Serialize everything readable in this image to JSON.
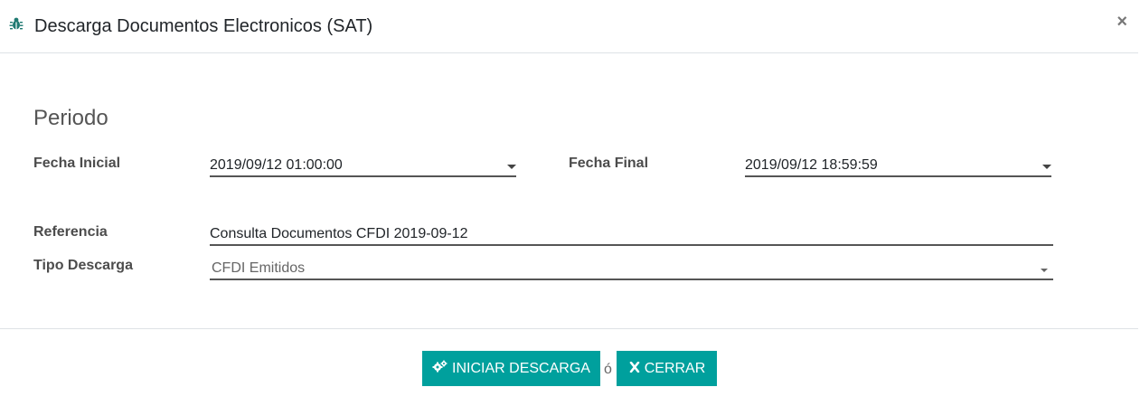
{
  "dialog": {
    "title": "Descarga Documentos Electronicos (SAT)",
    "close_symbol": "×",
    "icons": {
      "title": "bug-icon",
      "close": "close-icon"
    }
  },
  "form": {
    "section_title": "Periodo",
    "fecha_inicial": {
      "label": "Fecha Inicial",
      "value": "2019/09/12 01:00:00"
    },
    "fecha_final": {
      "label": "Fecha Final",
      "value": "2019/09/12 18:59:59"
    },
    "referencia": {
      "label": "Referencia",
      "value": "Consulta Documentos CFDI 2019-09-12"
    },
    "tipo_descarga": {
      "label": "Tipo Descarga",
      "value": "CFDI Emitidos"
    }
  },
  "footer": {
    "start_label": "INICIAR DESCARGA",
    "separator": "ó",
    "close_label": "CERRAR",
    "icons": {
      "start": "gears-icon",
      "close": "x-icon"
    }
  },
  "colors": {
    "primary": "#00a09d",
    "border": "#dee2e6"
  }
}
